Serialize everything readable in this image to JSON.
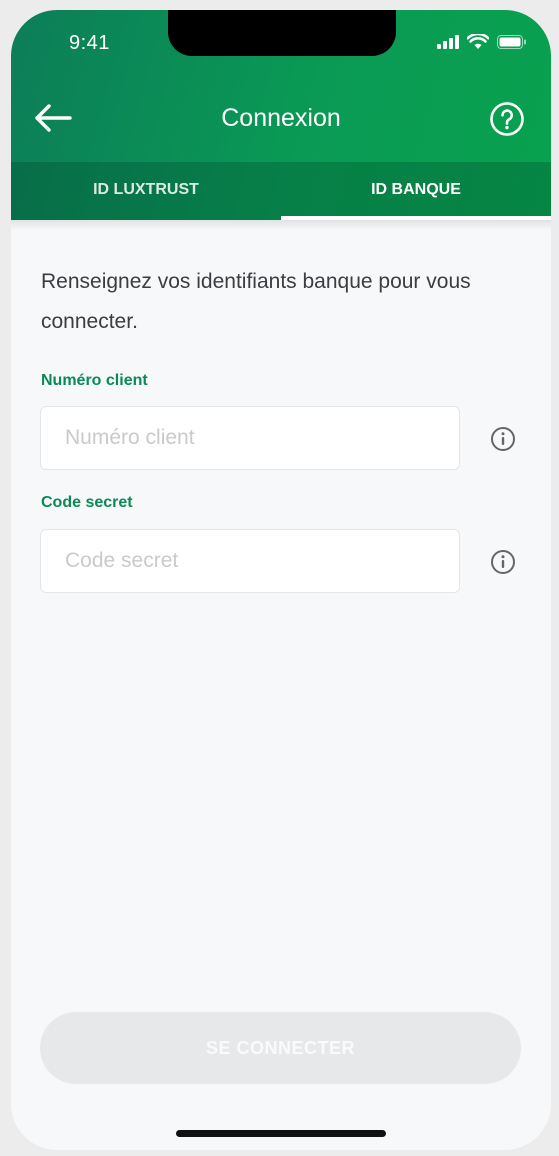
{
  "status_bar": {
    "time": "9:41",
    "icons": [
      "signal-icon",
      "wifi-icon",
      "battery-icon"
    ]
  },
  "header": {
    "title": "Connexion",
    "back_icon": "arrow-left-icon",
    "help_icon": "question-circle-icon"
  },
  "tabs": [
    {
      "label": "ID LUXTRUST",
      "active": false
    },
    {
      "label": "ID BANQUE",
      "active": true
    }
  ],
  "intro_text": "Renseignez vos identifiants banque pour vous connecter.",
  "fields": {
    "client_number": {
      "label": "Numéro client",
      "placeholder": "Numéro client",
      "value": ""
    },
    "secret_code": {
      "label": "Code secret",
      "placeholder": "Code secret",
      "value": ""
    }
  },
  "submit_button": {
    "label": "SE CONNECTER",
    "enabled": false
  },
  "colors": {
    "brand_green": "#0a9a55",
    "header_dark_green": "#0c7d58",
    "label_green": "#0b8a56",
    "disabled_button": "#e7e8ea"
  }
}
